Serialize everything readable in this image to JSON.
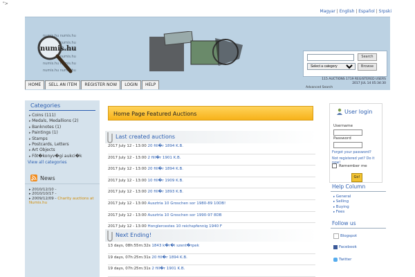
{
  "stray_text": "\">",
  "languages": [
    "Magyar",
    "English",
    "Español",
    "Srpski"
  ],
  "logo_text": "numis.hu",
  "search": {
    "button": "Search",
    "category_selected": "Select a category",
    "browse": "Browse",
    "advanced": "Advanced Search"
  },
  "stats": {
    "line1": "115 AUCTIONS 1719 REGISTERED USERS",
    "line2": "2017 JUL 14 05:34:30"
  },
  "nav": [
    "HOME",
    "SELL AN ITEM",
    "REGISTER NOW",
    "LOGIN",
    "HELP"
  ],
  "categories": {
    "title": "Categories",
    "items": [
      "Coins (111)",
      "Medals, Medallions (2)",
      "Banknotes (1)",
      "Paintings (1)",
      "Stamps",
      "Postcards, Letters",
      "Art Objects",
      "Fõt�konyv�gi aukci�k"
    ],
    "view_all": "View all categories"
  },
  "news": {
    "title": "News",
    "items": [
      {
        "date": "2010/12/10 -",
        "text": ""
      },
      {
        "date": "2010/10/17 -",
        "text": ""
      },
      {
        "date": "2009/12/09 -",
        "text": "Charity auctions at Numis.hu"
      }
    ]
  },
  "featured_title": "Home Page Featured Auctions",
  "last_created": {
    "title": "Last created auctions",
    "rows": [
      {
        "date": "2017 July 12 - 13:00",
        "item": "20 fill�r 1894 K.B."
      },
      {
        "date": "2017 July 12 - 13:00",
        "item": "2 fill�r 1901 K.B."
      },
      {
        "date": "2017 July 12 - 13:00",
        "item": "20 fill�r 1894 K.B."
      },
      {
        "date": "2017 July 12 - 13:00",
        "item": "10 fill�r 1909 K.B."
      },
      {
        "date": "2017 July 12 - 13:00",
        "item": "20 fill�r 1893 K.B."
      },
      {
        "date": "2017 July 12 - 13:00",
        "item": "Ausztria 10 Groschen sor 1980-89 10DB!"
      },
      {
        "date": "2017 July 12 - 13:00",
        "item": "Ausztria 10 Groschen sor 1990-97 8DB"
      },
      {
        "date": "2017 July 12 - 13:00",
        "item": "Honglercestes 10 reichspfennig 1940 F"
      }
    ]
  },
  "next_ending": {
    "title": "Next Ending!",
    "rows": [
      {
        "time": "13 days, 08h:55m:32s",
        "item": "1843 k�r�i szent�rpek"
      },
      {
        "time": "19 days, 07h:25m:31s",
        "item": "20 fill�r 1894 K.B."
      },
      {
        "time": "19 days, 07h:25m:31s",
        "item": "2 fill�r 1901 K.B."
      }
    ]
  },
  "login": {
    "title": "User login",
    "username_label": "Username",
    "password_label": "Password",
    "forgot": "Forgot your password?",
    "not_registered": "Not registered yet? Do it now!",
    "remember": "Remember me",
    "go": "Go!"
  },
  "help_column": {
    "title": "Help Column",
    "items": [
      "General",
      "Selling",
      "Buying",
      "Fees"
    ]
  },
  "follow_us": {
    "title": "Follow us",
    "items": [
      "Blogspot",
      "Facebook",
      "Twitter"
    ]
  },
  "colors": {
    "accent_blue": "#2a5db0",
    "header_bg": "#bcd2e3",
    "featured_gold": "#f7b21a",
    "sidebar_bg": "#d5e2ec"
  }
}
